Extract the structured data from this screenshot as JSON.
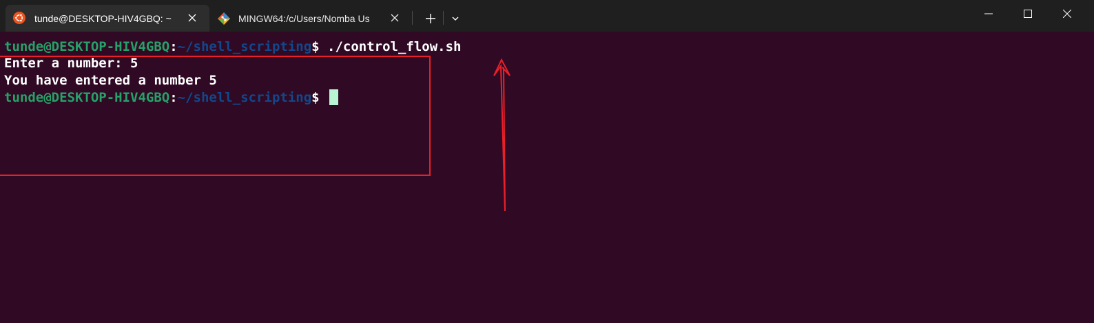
{
  "tabs": [
    {
      "label": "tunde@DESKTOP-HIV4GBQ: ~",
      "icon": "ubuntu-icon",
      "active": true,
      "icon_color": "#e95420"
    },
    {
      "label": "MINGW64:/c/Users/Nomba Us",
      "icon": "git-icon",
      "active": false
    }
  ],
  "tab_controls": {
    "new_tab_icon": "plus-icon",
    "dropdown_icon": "chevron-down-icon"
  },
  "window_controls": [
    "minimize-icon",
    "maximize-icon",
    "close-icon"
  ],
  "terminal": {
    "lines": [
      {
        "user_host": "tunde@DESKTOP-HIV4GBQ",
        "separator": ":",
        "path": "~/shell_scripting",
        "prompt_symbol": "$ ",
        "command": "./control_flow.sh"
      },
      {
        "text": "Enter a number: 5"
      },
      {
        "text": "You have entered a number 5"
      },
      {
        "user_host": "tunde@DESKTOP-HIV4GBQ",
        "separator": ":",
        "path": "~/shell_scripting",
        "prompt_symbol": "$ "
      }
    ],
    "colors": {
      "background": "#300a24",
      "user_host": "#26a269",
      "path": "#12488b",
      "text": "#ffffff",
      "cursor": "#b8f5d2"
    }
  },
  "annotations": {
    "highlight_box_color": "#e8202a",
    "arrow_color": "#e8202a"
  }
}
